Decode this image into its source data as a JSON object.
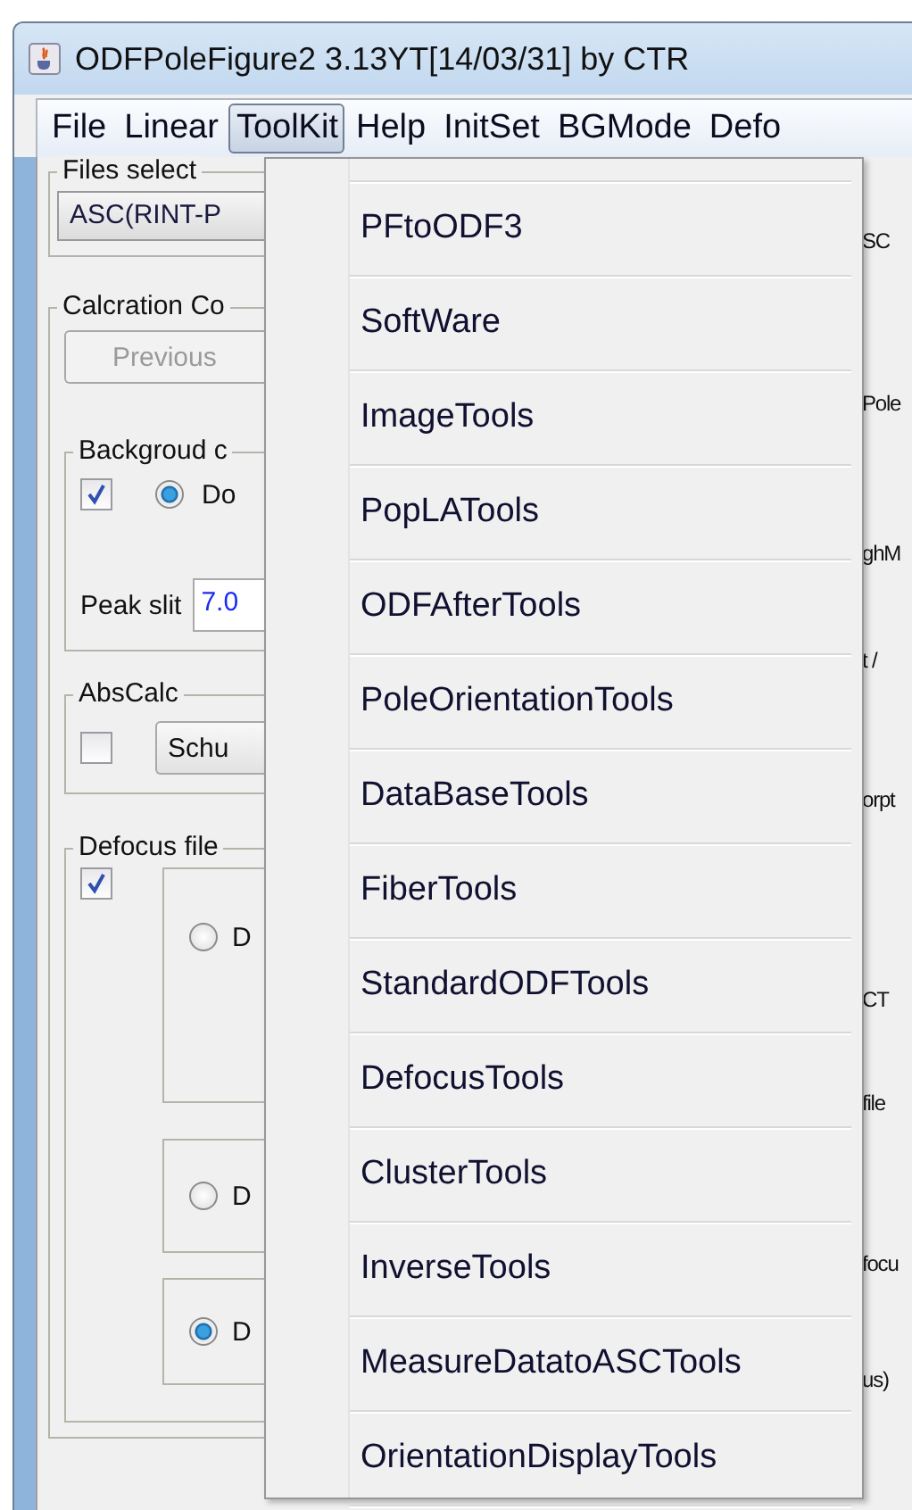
{
  "window": {
    "title": "ODFPoleFigure2 3.13YT[14/03/31] by CTR"
  },
  "menubar": [
    {
      "label": "File",
      "selected": false
    },
    {
      "label": "Linear",
      "selected": false
    },
    {
      "label": "ToolKit",
      "selected": true
    },
    {
      "label": "Help",
      "selected": false
    },
    {
      "label": "InitSet",
      "selected": false
    },
    {
      "label": "BGMode",
      "selected": false
    },
    {
      "label": "Defo",
      "selected": false
    }
  ],
  "toolkit_menu": {
    "items": [
      {
        "label": "PFtoODF3"
      },
      {
        "label": "SoftWare"
      },
      {
        "label": "ImageTools"
      },
      {
        "label": "PopLATools"
      },
      {
        "label": "ODFAfterTools"
      },
      {
        "label": "PoleOrientationTools"
      },
      {
        "label": "DataBaseTools"
      },
      {
        "label": "FiberTools"
      },
      {
        "label": "StandardODFTools"
      },
      {
        "label": "DefocusTools"
      },
      {
        "label": "ClusterTools"
      },
      {
        "label": "InverseTools"
      },
      {
        "label": "MeasureDatatoASCTools"
      },
      {
        "label": "OrientationDisplayTools"
      }
    ]
  },
  "files_select": {
    "legend": "Files select",
    "dropdown": "ASC(RINT-P"
  },
  "calculation": {
    "legend": "Calcration Co",
    "previous_button": {
      "label": "Previous",
      "disabled": true
    }
  },
  "background": {
    "legend": "Backgroud c",
    "checked": true,
    "radio": {
      "label": "Do",
      "selected": true
    },
    "peak_slit_label": "Peak slit",
    "peak_slit_value": "7.0"
  },
  "abs_calc": {
    "legend": "AbsCalc",
    "checked": false,
    "button": "Schu"
  },
  "defocus": {
    "legend": "Defocus file",
    "checked": true,
    "options": [
      {
        "label": "D",
        "selected": false
      },
      {
        "label": "D",
        "selected": false
      },
      {
        "label": "D",
        "selected": true
      }
    ]
  },
  "right_column_texts": [
    "SC",
    "Pole",
    "ghM",
    "t /",
    "orpt",
    "CT",
    "file",
    "focu",
    "us)"
  ]
}
